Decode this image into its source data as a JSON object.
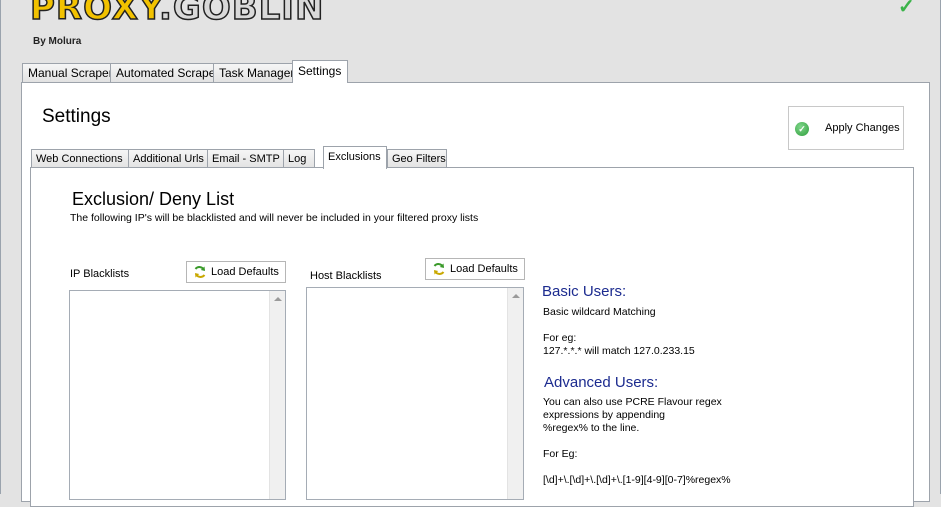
{
  "app": {
    "logo_part1": "PROXY",
    "logo_part2": ".GOBLIN",
    "logo_subtitle": "By Molura",
    "status_icon": "green-check-icon"
  },
  "main_tabs": [
    {
      "label": "Manual Scraper"
    },
    {
      "label": "Automated Scraper"
    },
    {
      "label": "Task Manager"
    },
    {
      "label": "Settings",
      "active": true
    }
  ],
  "settings": {
    "title": "Settings",
    "apply_label": "Apply Changes"
  },
  "sub_tabs": [
    {
      "label": "Web Connections"
    },
    {
      "label": "Additional Urls"
    },
    {
      "label": "Email - SMTP"
    },
    {
      "label": "Log"
    },
    {
      "label": "Exclusions",
      "active": true
    },
    {
      "label": "Geo Filters"
    }
  ],
  "exclusions": {
    "title": "Exclusion/ Deny List",
    "description": "The following IP's will be blacklisted and will never be included in your filtered proxy lists",
    "ip_label": "IP Blacklists",
    "host_label": "Host Blacklists",
    "load_defaults_label": "Load Defaults"
  },
  "help": {
    "basic_heading": "Basic Users:",
    "basic_text": "Basic wildcard Matching",
    "basic_eg": "For eg:",
    "basic_example": "127.*.*.* will match 127.0.233.15",
    "advanced_heading": "Advanced Users:",
    "advanced_line1": "You can also use PCRE Flavour regex",
    "advanced_line2": "expressions by appending",
    "advanced_line3": "%regex% to the line.",
    "advanced_eg": "For Eg:",
    "advanced_example": "[\\d]+\\.[\\d]+\\.[\\d]+\\.[1-9][4-9][0-7]%regex%"
  },
  "colors": {
    "accent_heading": "#1c2b8f",
    "logo_yellow": "#f2c200",
    "ok_green": "#3bb34a"
  }
}
